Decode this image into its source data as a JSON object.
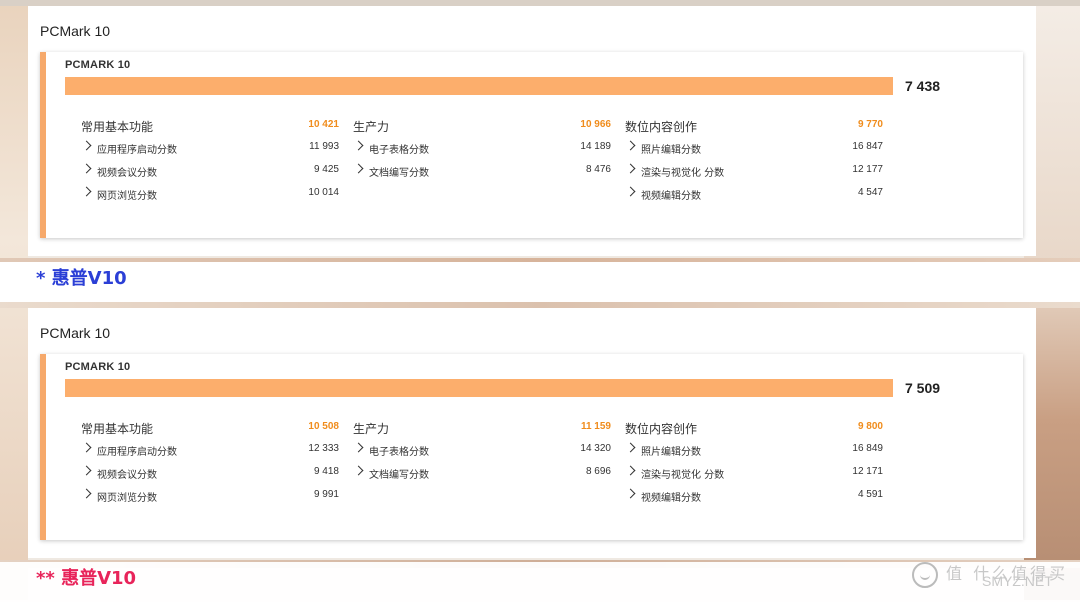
{
  "panels": [
    {
      "title": "PCMark 10",
      "card_title": "PCMARK 10",
      "total_score": "7 438",
      "bar_fraction": 1.0,
      "groups": [
        {
          "name": "常用基本功能",
          "score": "10 421",
          "rows": [
            {
              "label": "应用程序启动分数",
              "score": "11 993"
            },
            {
              "label": "视频会议分数",
              "score": "9 425"
            },
            {
              "label": "网页浏览分数",
              "score": "10 014"
            }
          ]
        },
        {
          "name": "生产力",
          "score": "10 966",
          "rows": [
            {
              "label": "电子表格分数",
              "score": "14 189"
            },
            {
              "label": "文档编写分数",
              "score": "8 476"
            }
          ]
        },
        {
          "name": "数位内容创作",
          "score": "9 770",
          "rows": [
            {
              "label": "照片编辑分数",
              "score": "16 847"
            },
            {
              "label": "渲染与视觉化 分数",
              "score": "12 177"
            },
            {
              "label": "视频编辑分数",
              "score": "4 547"
            }
          ]
        }
      ]
    },
    {
      "title": "PCMark 10",
      "card_title": "PCMARK 10",
      "total_score": "7 509",
      "bar_fraction": 1.0,
      "groups": [
        {
          "name": "常用基本功能",
          "score": "10 508",
          "rows": [
            {
              "label": "应用程序启动分数",
              "score": "12 333"
            },
            {
              "label": "视频会议分数",
              "score": "9 418"
            },
            {
              "label": "网页浏览分数",
              "score": "9 991"
            }
          ]
        },
        {
          "name": "生产力",
          "score": "11 159",
          "rows": [
            {
              "label": "电子表格分数",
              "score": "14 320"
            },
            {
              "label": "文档编写分数",
              "score": "8 696"
            }
          ]
        },
        {
          "name": "数位内容创作",
          "score": "9 800",
          "rows": [
            {
              "label": "照片编辑分数",
              "score": "16 849"
            },
            {
              "label": "渲染与视觉化 分数",
              "score": "12 171"
            },
            {
              "label": "视频编辑分数",
              "score": "4 591"
            }
          ]
        }
      ]
    }
  ],
  "captions": [
    {
      "text": "* 惠普V10",
      "color": "#2b3fd6"
    },
    {
      "text": "** 惠普V10",
      "color": "#e8245a"
    }
  ],
  "watermark": {
    "cn": "值 什么值得买",
    "en": "SMYZ.NET"
  },
  "colors": {
    "accent": "#f6a96b",
    "bar": "#fcae6c",
    "group_score": "#f08c1c"
  },
  "icons": {
    "row_expand": "chevron-right-icon",
    "watermark_logo": "smile-logo-icon"
  }
}
